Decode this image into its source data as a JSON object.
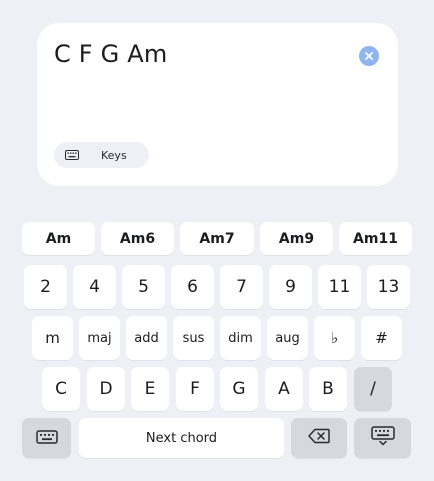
{
  "editor": {
    "chord_text": "C F G Am",
    "keys_chip_label": "Keys"
  },
  "suggestions": [
    "Am",
    "Am6",
    "Am7",
    "Am9",
    "Am11"
  ],
  "intervals": [
    "2",
    "4",
    "5",
    "6",
    "7",
    "9",
    "11",
    "13"
  ],
  "modifiers": [
    "m",
    "maj",
    "add",
    "sus",
    "dim",
    "aug",
    "♭",
    "#"
  ],
  "notes": [
    "C",
    "D",
    "E",
    "F",
    "G",
    "A",
    "B"
  ],
  "slash_label": "/",
  "bottom_bar": {
    "space_label": "Next chord"
  },
  "icons": {
    "clear": "close-circle-icon",
    "keys_chip": "keyboard-icon",
    "keyboard_switch": "keyboard-icon",
    "backspace": "backspace-icon",
    "keyboard_hide": "keyboard-hide-icon"
  },
  "colors": {
    "background": "#eef0f5",
    "clear_button": "#8fb4f0",
    "gray_key": "#d6d8de"
  }
}
